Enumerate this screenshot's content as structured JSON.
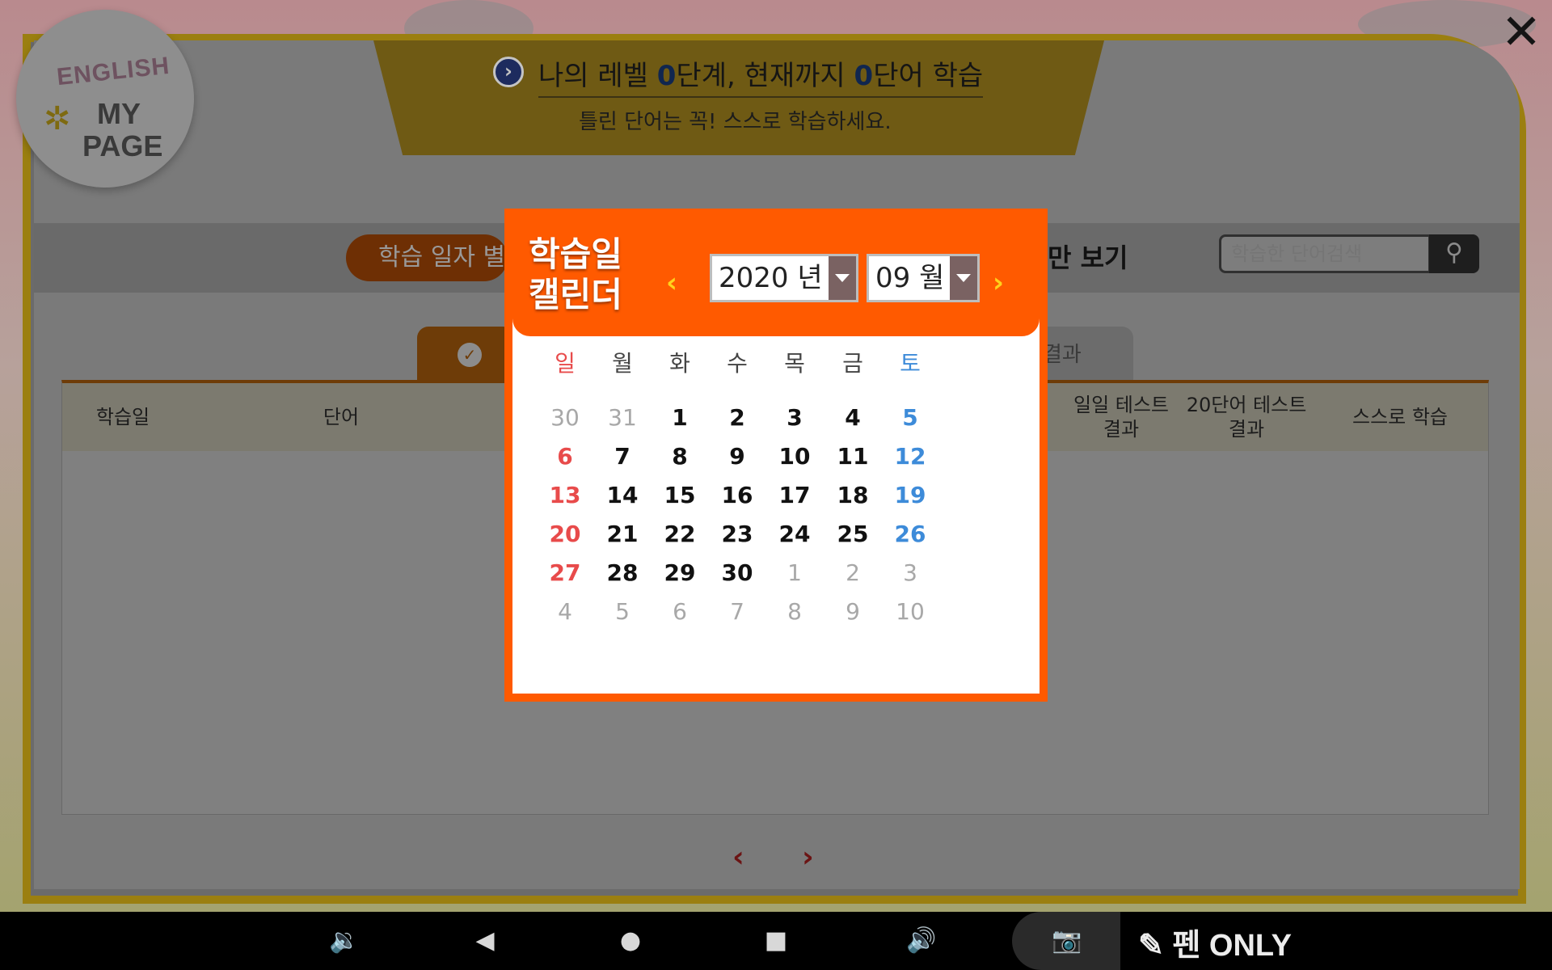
{
  "header": {
    "logo_top": "ENGLISH",
    "logo_mid": "MY",
    "logo_bottom": "PAGE",
    "close": "✕"
  },
  "banner": {
    "title_pre": "나의 레벨 ",
    "level": "0",
    "title_mid": "단계, 현재까지 ",
    "words": "0",
    "title_post": "단어 학습",
    "subtitle": "틀린 단어는 꼭! 스스로 학습하세요."
  },
  "toolbar": {
    "tab_bydate": "학습 일자 별",
    "view_only": "만 보기",
    "search_placeholder": "학습한 단어검색"
  },
  "subtabs": {
    "right_label": "결과"
  },
  "table": {
    "headers": [
      "학습일",
      "단어",
      "일일 테스트\n결과",
      "20단어 테스트\n결과",
      "스스로 학습"
    ]
  },
  "pager": {
    "prev": "‹",
    "next": "›"
  },
  "calendar": {
    "title_line1": "학습일",
    "title_line2": "캘린더",
    "year": "2020 년",
    "month": "09 월",
    "weekdays": [
      "일",
      "월",
      "화",
      "수",
      "목",
      "금",
      "토"
    ],
    "weeks": [
      [
        {
          "d": "30",
          "m": true
        },
        {
          "d": "31",
          "m": true
        },
        {
          "d": "1"
        },
        {
          "d": "2"
        },
        {
          "d": "3"
        },
        {
          "d": "4"
        },
        {
          "d": "5"
        }
      ],
      [
        {
          "d": "6"
        },
        {
          "d": "7"
        },
        {
          "d": "8"
        },
        {
          "d": "9"
        },
        {
          "d": "10"
        },
        {
          "d": "11"
        },
        {
          "d": "12"
        }
      ],
      [
        {
          "d": "13"
        },
        {
          "d": "14"
        },
        {
          "d": "15"
        },
        {
          "d": "16"
        },
        {
          "d": "17"
        },
        {
          "d": "18"
        },
        {
          "d": "19"
        }
      ],
      [
        {
          "d": "20"
        },
        {
          "d": "21"
        },
        {
          "d": "22"
        },
        {
          "d": "23"
        },
        {
          "d": "24"
        },
        {
          "d": "25"
        },
        {
          "d": "26"
        }
      ],
      [
        {
          "d": "27"
        },
        {
          "d": "28"
        },
        {
          "d": "29"
        },
        {
          "d": "30"
        },
        {
          "d": "1",
          "m": true
        },
        {
          "d": "2",
          "m": true
        },
        {
          "d": "3",
          "m": true
        }
      ],
      [
        {
          "d": "4",
          "m": true
        },
        {
          "d": "5",
          "m": true
        },
        {
          "d": "6",
          "m": true
        },
        {
          "d": "7",
          "m": true
        },
        {
          "d": "8",
          "m": true
        },
        {
          "d": "9",
          "m": true
        },
        {
          "d": "10",
          "m": true
        }
      ]
    ],
    "colors": {
      "accent": "#ff5a00",
      "sunday": "#e84b4b",
      "saturday": "#3d8bd9",
      "arrow": "#ffd21c"
    }
  },
  "navbar": {
    "icons": [
      "volume-down-icon",
      "back-icon",
      "home-icon",
      "recents-icon",
      "volume-up-icon",
      "camera-icon",
      "pen-icon"
    ],
    "pen_label": "펜 ONLY"
  }
}
